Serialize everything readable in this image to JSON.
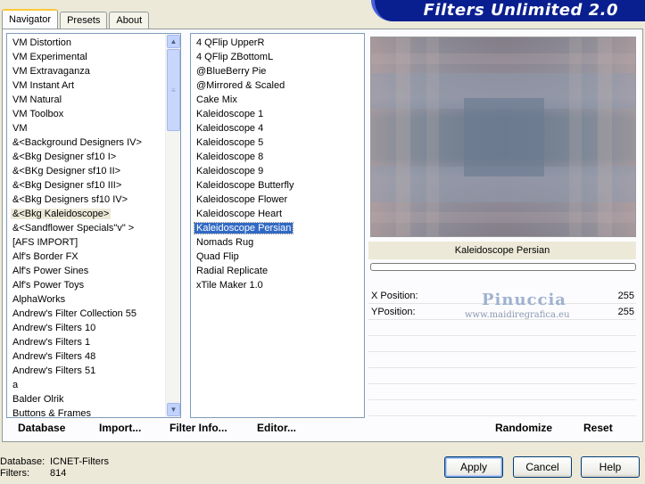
{
  "app": {
    "title": "Filters Unlimited 2.0"
  },
  "tabs": [
    {
      "label": "Navigator",
      "active": true
    },
    {
      "label": "Presets",
      "active": false
    },
    {
      "label": "About",
      "active": false
    }
  ],
  "categories": [
    "VM Distortion",
    "VM Experimental",
    "VM Extravaganza",
    "VM Instant Art",
    "VM Natural",
    "VM Toolbox",
    "VM",
    "&<Background Designers IV>",
    "&<Bkg Designer sf10 I>",
    "&<BKg Designer sf10 II>",
    "&<Bkg Designer sf10 III>",
    "&<Bkg Designers sf10 IV>",
    "&<Bkg Kaleidoscope>",
    "&<Sandflower Specials\"v\" >",
    "[AFS IMPORT]",
    "Alf's Border FX",
    "Alf's Power Sines",
    "Alf's Power Toys",
    "AlphaWorks",
    "Andrew's Filter Collection 55",
    "Andrew's Filters 10",
    "Andrew's Filters 1",
    "Andrew's Filters 48",
    "Andrew's Filters 51",
    "a",
    "Balder Olrik",
    "Buttons & Frames"
  ],
  "filters": [
    "4 QFlip UpperR",
    "4 QFlip ZBottomL",
    "@BlueBerry Pie",
    "@Mirrored & Scaled",
    "Cake Mix",
    "Kaleidoscope 1",
    "Kaleidoscope 4",
    "Kaleidoscope 5",
    "Kaleidoscope 8",
    "Kaleidoscope 9",
    "Kaleidoscope Butterfly",
    "Kaleidoscope Flower",
    "Kaleidoscope Heart",
    "Kaleidoscope Persian",
    "Nomads Rug",
    "Quad Flip",
    "Radial Replicate",
    "xTile Maker 1.0"
  ],
  "selected_category": "&<Bkg Kaleidoscope>",
  "selected_filter": "Kaleidoscope Persian",
  "bottom_links": {
    "database": "Database",
    "import": "Import...",
    "filter_info": "Filter Info...",
    "editor": "Editor...",
    "randomize": "Randomize",
    "reset": "Reset"
  },
  "preview": {
    "filter_name": "Kaleidoscope Persian"
  },
  "params": [
    {
      "label": "X Position:",
      "value": "255"
    },
    {
      "label": "YPosition:",
      "value": "255"
    }
  ],
  "watermark": {
    "name": "Pinuccia",
    "url": "www.maidiregrafica.eu"
  },
  "status": {
    "database_label": "Database:",
    "database_value": "ICNET-Filters",
    "filters_label": "Filters:",
    "filters_value": "814"
  },
  "buttons": {
    "apply": "Apply",
    "cancel": "Cancel",
    "help": "Help"
  },
  "colors": {
    "banner": "#0a1f8f",
    "selection": "#316ac5",
    "window": "#ece9d8"
  }
}
